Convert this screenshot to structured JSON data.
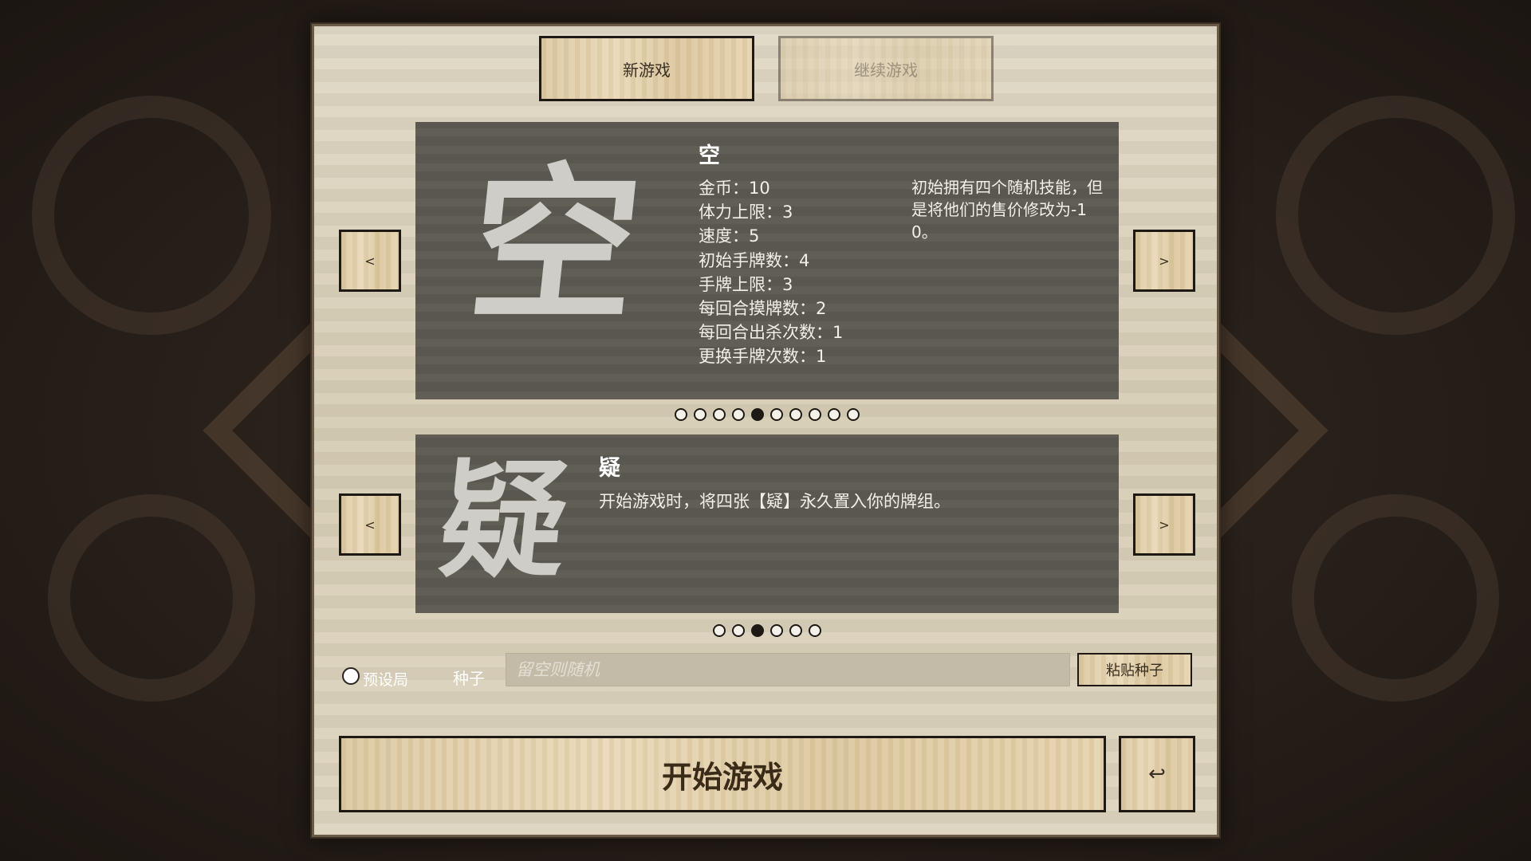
{
  "tabs": {
    "new_game": "新游戏",
    "continue_game": "继续游戏"
  },
  "character": {
    "glyph": "空",
    "name": "空",
    "stats": [
      "金币：10",
      "体力上限：3",
      "速度：5",
      "初始手牌数：4",
      "手牌上限：3",
      "每回合摸牌数：2",
      "每回合出杀次数：1",
      "更换手牌次数：1"
    ],
    "description": "初始拥有四个随机技能，但是将他们的售价修改为-10。",
    "page_count": 10,
    "active_index": 4
  },
  "modifier": {
    "glyph": "疑",
    "name": "疑",
    "description": "开始游戏时，将四张【疑】永久置入你的牌组。",
    "page_count": 6,
    "active_index": 2
  },
  "nav": {
    "prev": "<",
    "next": ">"
  },
  "options": {
    "preset_label": "预设局",
    "preset_checked": false,
    "seed_label": "种子",
    "seed_placeholder": "留空则随机",
    "seed_value": "",
    "paste_seed": "粘贴种子"
  },
  "footer": {
    "start_game": "开始游戏",
    "back_symbol": "↩"
  }
}
